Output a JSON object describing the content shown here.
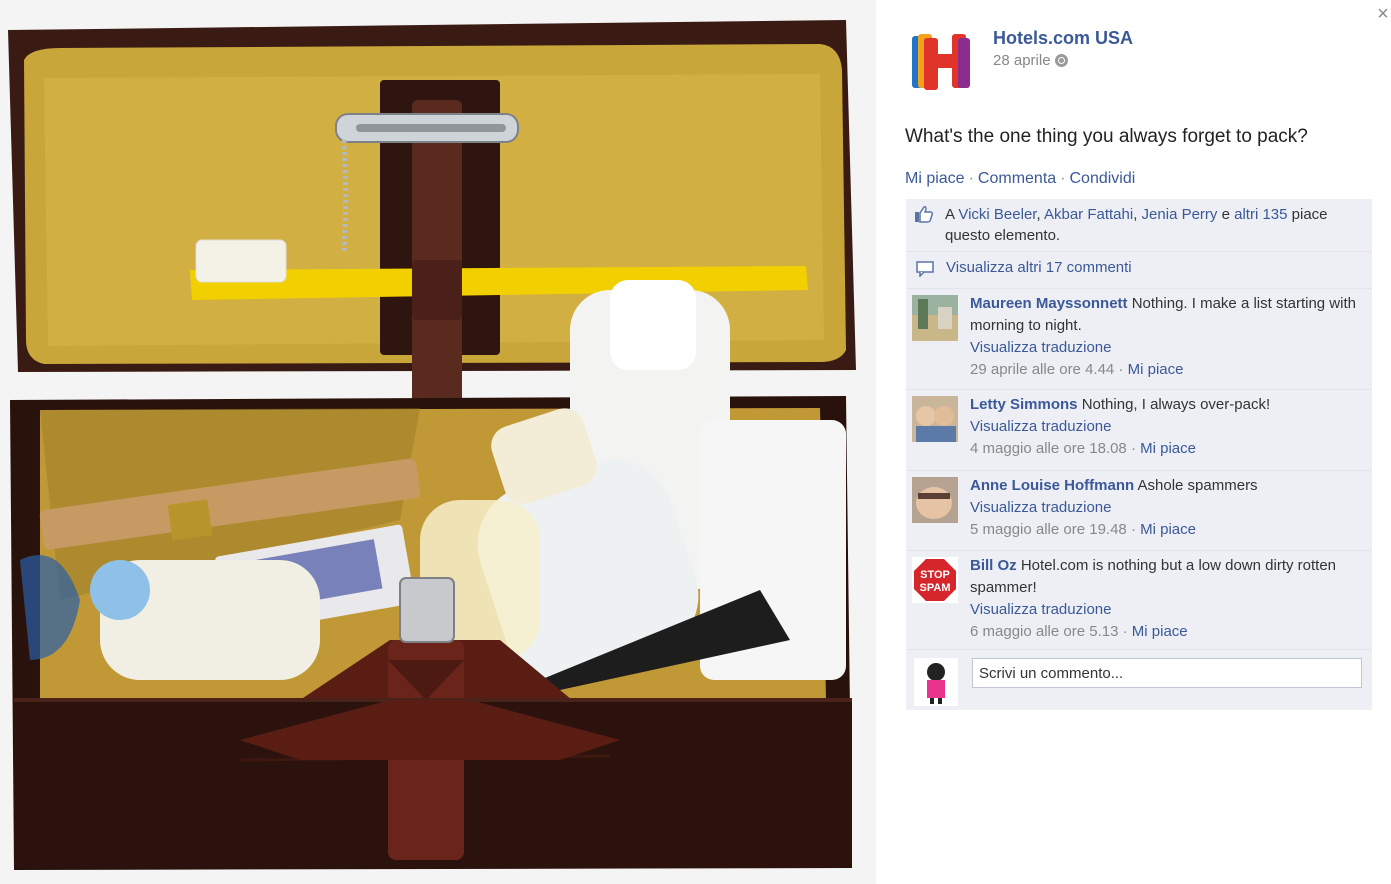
{
  "window": {
    "close_glyph": "×"
  },
  "photo": {
    "description_icon": "toiletry-kit-photo"
  },
  "post": {
    "page_name": "Hotels.com USA",
    "date": "28 aprile",
    "audience_icon": "globe-icon",
    "text": "What's the one thing you always forget to pack?",
    "actions": {
      "like": "Mi piace",
      "comment": "Commenta",
      "share": "Condividi",
      "separator": "·"
    }
  },
  "likes": {
    "prefix": "A",
    "names": [
      "Vicki Beeler",
      "Akbar Fattahi",
      "Jenia Perry"
    ],
    "conjunction": "e",
    "others": "altri 135",
    "suffix": "piace questo elemento."
  },
  "view_more": "Visualizza altri 17 commenti",
  "comments": [
    {
      "author": "Maureen Mayssonnett",
      "text": "Nothing. I make a list starting with morning to night.",
      "translate": "Visualizza traduzione",
      "time": "29 aprile alle ore 4.44",
      "like": "Mi piace"
    },
    {
      "author": "Letty Simmons",
      "text": "Nothing, I always over-pack!",
      "translate": "Visualizza traduzione",
      "time": "4 maggio alle ore 18.08",
      "like": "Mi piace"
    },
    {
      "author": "Anne Louise Hoffmann",
      "text": "Ashole spammers",
      "translate": "Visualizza traduzione",
      "time": "5 maggio alle ore 19.48",
      "like": "Mi piace"
    },
    {
      "author": "Bill Oz",
      "text": "Hotel.com is nothing but a low down dirty rotten spammer!",
      "translate": "Visualizza traduzione",
      "time": "6 maggio alle ore 5.13",
      "like": "Mi piace",
      "avatar_text": [
        "STOP",
        "SPAM"
      ]
    }
  ],
  "composer": {
    "placeholder": "Scrivi un commento..."
  },
  "colors": {
    "link": "#3b5998",
    "ufi_bg": "#edeff4",
    "text": "#333333",
    "meta": "#888888"
  }
}
